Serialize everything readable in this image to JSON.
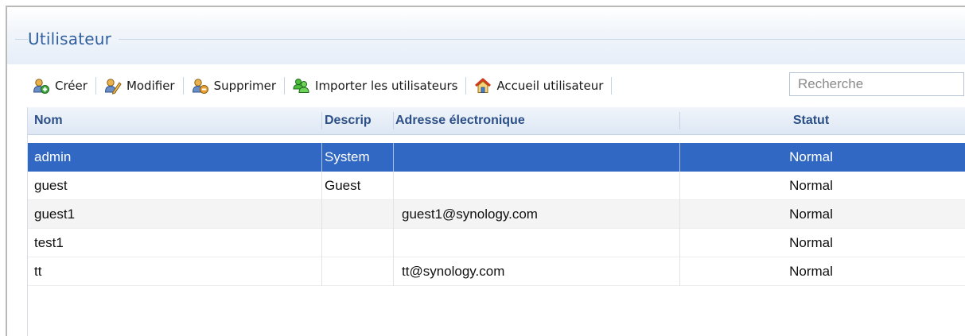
{
  "window": {
    "title": "Utilisateur"
  },
  "toolbar": {
    "create_label": "Créer",
    "edit_label": "Modifier",
    "delete_label": "Supprimer",
    "import_label": "Importer les utilisateurs",
    "home_label": "Accueil utilisateur",
    "search_placeholder": "Recherche"
  },
  "table": {
    "columns": [
      "Nom",
      "Descrip",
      "Adresse électronique",
      "Statut"
    ],
    "rows": [
      {
        "name": "admin",
        "description": "System",
        "email": "",
        "status": "Normal",
        "selected": true
      },
      {
        "name": "guest",
        "description": "Guest",
        "email": "",
        "status": "Normal",
        "selected": false
      },
      {
        "name": "guest1",
        "description": "",
        "email": "guest1@synology.com",
        "status": "Normal",
        "selected": false
      },
      {
        "name": "test1",
        "description": "",
        "email": "",
        "status": "Normal",
        "selected": false
      },
      {
        "name": "tt",
        "description": "",
        "email": "tt@synology.com",
        "status": "Normal",
        "selected": false
      }
    ]
  },
  "icons": {
    "create": "user-add-icon",
    "edit": "user-edit-icon",
    "delete": "user-delete-icon",
    "import": "users-import-icon",
    "home": "house-icon"
  },
  "colors": {
    "title": "#2f5f9f",
    "selection": "#3168c4",
    "header_text": "#2b4f86"
  }
}
